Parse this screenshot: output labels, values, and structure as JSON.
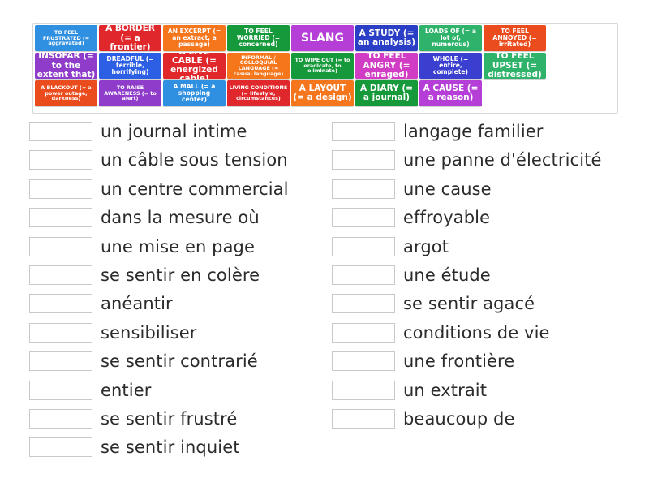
{
  "tiles": [
    {
      "text": "TO FEEL FRUSTRATED (= aggravated)",
      "color": "#2f8fe0",
      "size": "xs"
    },
    {
      "text": "A BORDER (= a frontier)",
      "color": "#e0282c",
      "size": "m"
    },
    {
      "text": "AN EXCERPT (= an extract, a passage)",
      "color": "#f6761d",
      "size": "s"
    },
    {
      "text": "TO FEEL WORRIED (= concerned)",
      "color": "#16993a",
      "size": "s"
    },
    {
      "text": "SLANG",
      "color": "#b43ed6",
      "size": "l"
    },
    {
      "text": "A STUDY (= an analysis)",
      "color": "#2a3fc6",
      "size": "m"
    },
    {
      "text": "LOADS OF (= a lot of, numerous)",
      "color": "#2fb36b",
      "size": "s"
    },
    {
      "text": "TO FEEL ANNOYED (= irritated)",
      "color": "#ea4c1d",
      "size": "s"
    },
    {
      "text": "INSOFAR (= to the extent that)",
      "color": "#8e3cc9",
      "size": "m"
    },
    {
      "text": "DREADFUL (= terrible, horrifying)",
      "color": "#2d5fe4",
      "size": "s"
    },
    {
      "text": "A LIVE CABLE (= energized cable)",
      "color": "#e0282c",
      "size": "m"
    },
    {
      "text": "INFORMAL / COLLOQUIAL LANGUAGE (= casual language)",
      "color": "#f5761b",
      "size": "xs"
    },
    {
      "text": "TO WIPE OUT (= to eradicate, to eliminate)",
      "color": "#16993a",
      "size": "xs"
    },
    {
      "text": "TO FEEL ANGRY (= enraged)",
      "color": "#d13cc4",
      "size": "m"
    },
    {
      "text": "WHOLE (= entire, complete)",
      "color": "#3a3fd0",
      "size": "s"
    },
    {
      "text": "TO FEEL UPSET (= distressed)",
      "color": "#2fb36b",
      "size": "m"
    },
    {
      "text": "A BLACKOUT (= a power outage, darkness)",
      "color": "#ea4c1d",
      "size": "xs"
    },
    {
      "text": "TO RAISE AWARENESS (= to alert)",
      "color": "#8e3cc9",
      "size": "xs"
    },
    {
      "text": "A MALL (= a shopping center)",
      "color": "#2f8fe0",
      "size": "s"
    },
    {
      "text": "LIVING CONDITIONS (= lifestyle, circumstances)",
      "color": "#e0282c",
      "size": "xs"
    },
    {
      "text": "A LAYOUT (= a design)",
      "color": "#f6761d",
      "size": "m"
    },
    {
      "text": "A DIARY (= a journal)",
      "color": "#16993a",
      "size": "m"
    },
    {
      "text": "A CAUSE (= a reason)",
      "color": "#b43ed6",
      "size": "m"
    }
  ],
  "left_items": [
    "un journal intime",
    "un câble sous tension",
    "un centre commercial",
    "dans la mesure où",
    "une mise en page",
    "se sentir en colère",
    "anéantir",
    "sensibiliser",
    "se sentir contrarié",
    "entier",
    "se sentir frustré",
    "se sentir inquiet"
  ],
  "right_items": [
    "langage familier",
    "une panne d'électricité",
    "une cause",
    "effroyable",
    "argot",
    "une étude",
    "se sentir agacé",
    "conditions de vie",
    "une frontière",
    "un extrait",
    "beaucoup de"
  ]
}
